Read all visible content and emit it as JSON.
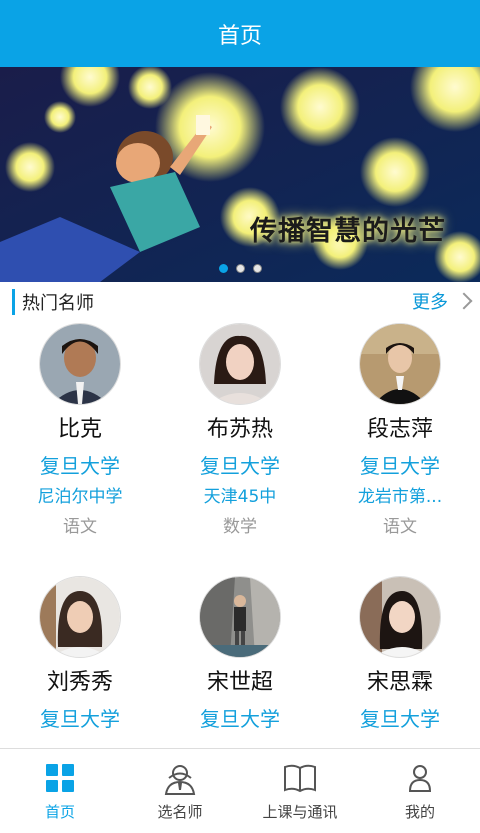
{
  "header": {
    "title": "首页"
  },
  "banner": {
    "caption": "传播智慧的光芒",
    "slides": 3,
    "active_slide": 1
  },
  "section": {
    "title": "热门名师",
    "more_label": "更多"
  },
  "teachers": [
    {
      "name": "比克",
      "university": "复旦大学",
      "school": "尼泊尔中学",
      "subject": "语文"
    },
    {
      "name": "布苏热",
      "university": "复旦大学",
      "school": "天津45中",
      "subject": "数学"
    },
    {
      "name": "段志萍",
      "university": "复旦大学",
      "school": "龙岩市第...",
      "subject": "语文"
    },
    {
      "name": "刘秀秀",
      "university": "复旦大学",
      "school": "",
      "subject": ""
    },
    {
      "name": "宋世超",
      "university": "复旦大学",
      "school": "",
      "subject": ""
    },
    {
      "name": "宋思霖",
      "university": "复旦大学",
      "school": "",
      "subject": ""
    }
  ],
  "tabbar": {
    "items": [
      {
        "label": "首页",
        "icon": "grid-icon",
        "active": true
      },
      {
        "label": "选名师",
        "icon": "teacher-icon",
        "active": false
      },
      {
        "label": "上课与通讯",
        "icon": "book-icon",
        "active": false
      },
      {
        "label": "我的",
        "icon": "person-icon",
        "active": false
      }
    ]
  },
  "colors": {
    "primary": "#0aa3e6",
    "link": "#13a0dc",
    "muted": "#999999"
  }
}
